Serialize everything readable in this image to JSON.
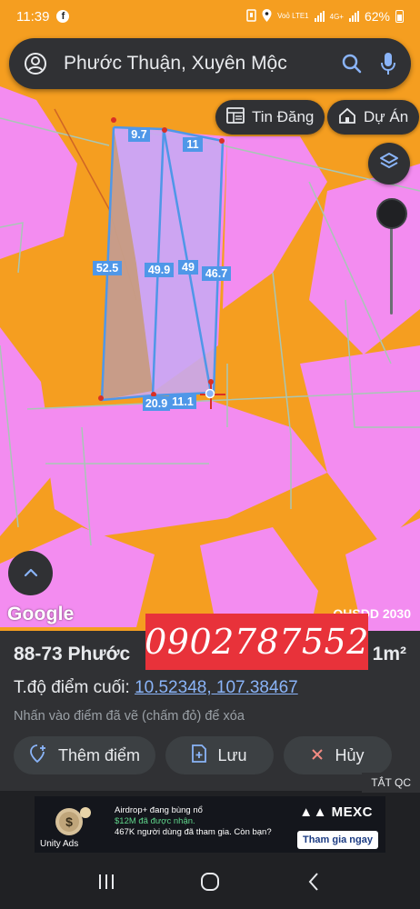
{
  "status_bar": {
    "time": "11:39",
    "facebook_icon": "f",
    "network": "Voỏ LTE1",
    "network_type": "4G+",
    "battery": "62%"
  },
  "search": {
    "text": "Phước Thuận, Xuyên Mộc"
  },
  "chips": {
    "listing_label": "Tin Đăng",
    "project_label": "Dự Án"
  },
  "map": {
    "colors": {
      "residential": "#f59e20",
      "agricultural": "#f38cf0",
      "parcel_fill": "#c9a7f2",
      "parcel_fill_alt": "#c79a6d",
      "edge": "#4f97e8",
      "vertex": "#d93025"
    },
    "dimension_labels": [
      "9.7",
      "11",
      "52.5",
      "49.9",
      "49",
      "46.7",
      "20.9",
      "11.1"
    ],
    "google_logo": "Google",
    "layer_label": "QHSDD 2030"
  },
  "sheet": {
    "title": "88-73 Phước",
    "area_suffix": "1m²",
    "phone_overlay": "0902787552",
    "coord_prefix": "T.độ điểm cuối:",
    "coord_value": "10.52348, 107.38467",
    "hint": "Nhấn vào điểm đã vẽ (chấm đỏ) để xóa",
    "add_point_label": "Thêm điểm",
    "save_label": "Lưu",
    "cancel_label": "Hủy",
    "hide_ads_label": "TẮT QC"
  },
  "ad": {
    "line1": "Airdrop+ đang bùng nổ",
    "line2": "$12M đã được nhận.",
    "line3": "467K người dùng đã tham gia. Còn bạn?",
    "brand": "MEXC",
    "cta": "Tham gia ngay",
    "network": "Unity Ads"
  }
}
